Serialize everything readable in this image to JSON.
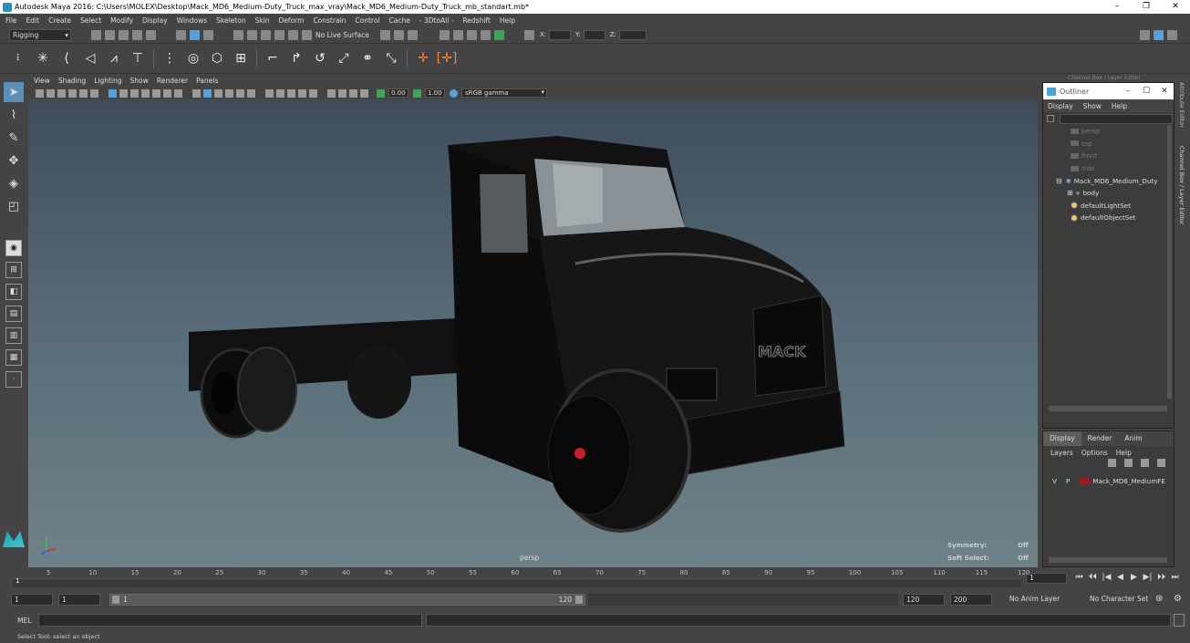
{
  "window": {
    "title": "Autodesk Maya 2016: C:\\Users\\MOLEX\\Desktop\\Mack_MD6_Medium-Duty_Truck_max_vray\\Mack_MD6_Medium-Duty_Truck_mb_standart.mb*",
    "min": "–",
    "restore": "❐",
    "close": "✕"
  },
  "menubar": [
    "File",
    "Edit",
    "Create",
    "Select",
    "Modify",
    "Display",
    "Windows",
    "Skeleton",
    "Skin",
    "Deform",
    "Constrain",
    "Control",
    "Cache",
    "- 3DtoAll -",
    "Redshift",
    "Help"
  ],
  "statusline": {
    "mode": "Rigging",
    "live_surface": "No Live Surface",
    "x_label": "X:",
    "y_label": "Y:",
    "z_label": "Z:"
  },
  "viewport": {
    "menu": [
      "View",
      "Shading",
      "Lighting",
      "Show",
      "Renderer",
      "Panels"
    ],
    "exposure": "0.00",
    "gamma": "1.00",
    "color_space": "sRGB gamma",
    "camera_label": "persp",
    "symmetry_label": "Symmetry:",
    "symmetry_value": "Off",
    "softselect_label": "Soft Select:",
    "softselect_value": "Off"
  },
  "panel_header": "Channel Box / Layer Editor",
  "outliner": {
    "title": "Outliner",
    "menu": [
      "Display",
      "Show",
      "Help"
    ],
    "items": [
      {
        "label": "persp",
        "indent": 30,
        "kind": "camera"
      },
      {
        "label": "top",
        "indent": 30,
        "kind": "camera"
      },
      {
        "label": "front",
        "indent": 30,
        "kind": "camera"
      },
      {
        "label": "side",
        "indent": 30,
        "kind": "camera"
      },
      {
        "label": "Mack_MD6_Medium_Duty",
        "indent": 14,
        "kind": "group"
      },
      {
        "label": "body",
        "indent": 26,
        "kind": "mesh"
      },
      {
        "label": "defaultLightSet",
        "indent": 30,
        "kind": "set"
      },
      {
        "label": "defaultObjectSet",
        "indent": 30,
        "kind": "set"
      }
    ]
  },
  "channel": {
    "tabs": [
      "Display",
      "Render",
      "Anim"
    ],
    "menu": [
      "Layers",
      "Options",
      "Help"
    ],
    "layer": {
      "v": "V",
      "p": "P",
      "name": "Mack_MD6_MediumFE",
      "color": "#a01825"
    }
  },
  "sidetabs": [
    "Attribute Editor",
    "Channel Box / Layer Editor"
  ],
  "timeline": {
    "ticks": [
      "5",
      "10",
      "15",
      "20",
      "25",
      "30",
      "35",
      "40",
      "45",
      "50",
      "55",
      "60",
      "65",
      "70",
      "75",
      "80",
      "85",
      "90",
      "95",
      "100",
      "105",
      "110",
      "115",
      "120"
    ],
    "current_start": "1",
    "current_frame": "1",
    "play_buttons": [
      "⏮",
      "⏴⏴",
      "|◀",
      "◀",
      "▶",
      "▶|",
      "⏵⏵",
      "⏭"
    ]
  },
  "range": {
    "start": "1",
    "playback_start": "1",
    "slider_start": "1",
    "slider_end": "120",
    "playback_end": "120",
    "end": "200",
    "anim_layer": "No Anim Layer",
    "char_set": "No Character Set"
  },
  "command": {
    "label": "MEL"
  },
  "status": {
    "text": "Select Tool: select an object"
  }
}
